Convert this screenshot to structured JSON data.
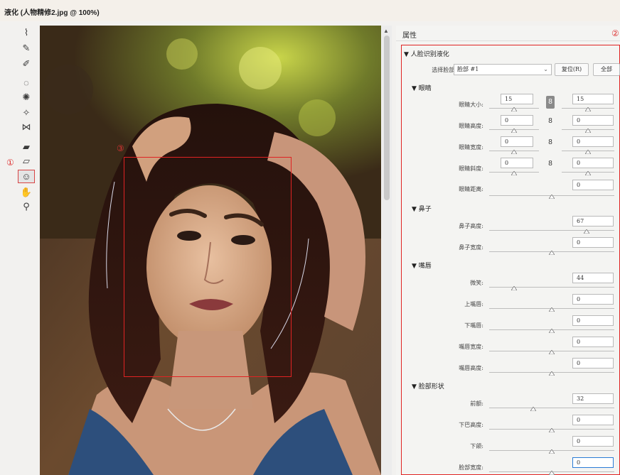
{
  "window": {
    "title": "液化 (人物精修2.jpg @ 100%)"
  },
  "markers": {
    "one": "①",
    "two": "②",
    "three": "③"
  },
  "toolbar": {
    "tools": [
      {
        "name": "forward-warp-tool",
        "glyph": "⌇"
      },
      {
        "name": "reconstruct-tool",
        "glyph": "✎"
      },
      {
        "name": "smooth-tool",
        "glyph": "✐"
      },
      {
        "name": "twirl-tool",
        "glyph": "◌"
      },
      {
        "name": "pucker-tool",
        "glyph": "✺"
      },
      {
        "name": "bloat-tool",
        "glyph": "✧"
      },
      {
        "name": "push-left-tool",
        "glyph": "⋈"
      },
      {
        "name": "freeze-mask-tool",
        "glyph": "▰"
      },
      {
        "name": "thaw-mask-tool",
        "glyph": "▱"
      },
      {
        "name": "face-tool",
        "glyph": "☺"
      },
      {
        "name": "hand-tool",
        "glyph": "✋"
      },
      {
        "name": "zoom-tool",
        "glyph": "⚲"
      }
    ]
  },
  "properties": {
    "header": "属性",
    "face_aware": {
      "title": "▼ 人脸识别液化",
      "select_face_label": "选择脸部:",
      "select_face_value": "脸部 #1",
      "reset_button": "复位(R)",
      "all_button": "全部"
    },
    "eyes": {
      "title": "▼ 眼睛",
      "rows": [
        {
          "label": "眼睛大小:",
          "left": "15",
          "right": "15",
          "linked": true,
          "left_level": 0.5,
          "right_level": 0.5
        },
        {
          "label": "眼睛高度:",
          "left": "0",
          "right": "0",
          "linked": false,
          "left_level": 0.5,
          "right_level": 0.5
        },
        {
          "label": "眼睛宽度:",
          "left": "0",
          "right": "0",
          "linked": false,
          "left_level": 0.5,
          "right_level": 0.5
        },
        {
          "label": "眼睛斜度:",
          "left": "0",
          "right": "0",
          "linked": false,
          "left_level": 0.5,
          "right_level": 0.5
        }
      ],
      "distance": {
        "label": "眼睛距离:",
        "value": "0",
        "level": 0.5
      }
    },
    "nose": {
      "title": "▼ 鼻子",
      "rows": [
        {
          "label": "鼻子高度:",
          "value": "67",
          "level": 0.78
        },
        {
          "label": "鼻子宽度:",
          "value": "0",
          "level": 0.5
        }
      ]
    },
    "mouth": {
      "title": "▼ 嘴唇",
      "rows": [
        {
          "label": "微笑:",
          "value": "44",
          "level": 0.2
        },
        {
          "label": "上嘴唇:",
          "value": "0",
          "level": 0.5
        },
        {
          "label": "下嘴唇:",
          "value": "0",
          "level": 0.5
        },
        {
          "label": "嘴唇宽度:",
          "value": "0",
          "level": 0.5
        },
        {
          "label": "嘴唇高度:",
          "value": "0",
          "level": 0.5
        }
      ]
    },
    "face_shape": {
      "title": "▼ 脸部形状",
      "rows": [
        {
          "label": "前额:",
          "value": "32",
          "level": 0.35
        },
        {
          "label": "下巴高度:",
          "value": "0",
          "level": 0.5
        },
        {
          "label": "下颌:",
          "value": "0",
          "level": 0.5
        },
        {
          "label": "脸部宽度:",
          "value": "0",
          "level": 0.5
        }
      ]
    }
  },
  "colors": {
    "annotation_red": "#e02323",
    "focus_blue": "#2a7cd6"
  }
}
